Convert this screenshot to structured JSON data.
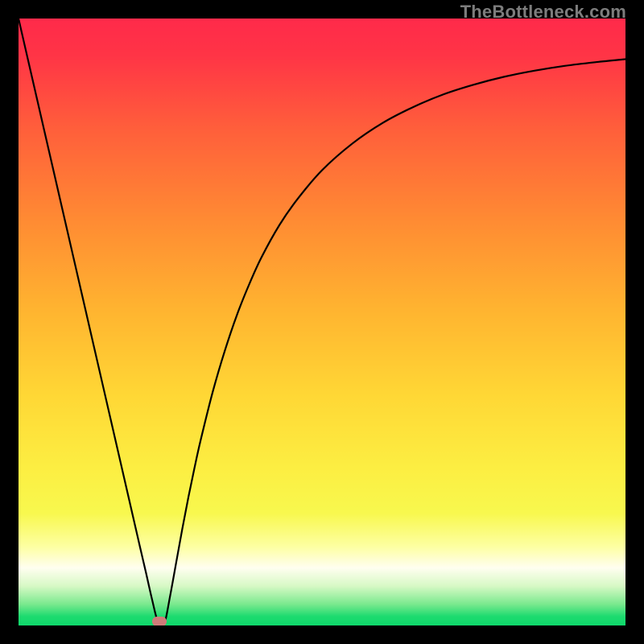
{
  "watermark": "TheBottleneck.com",
  "chart_data": {
    "type": "line",
    "title": "",
    "xlabel": "",
    "ylabel": "",
    "xlim": [
      0,
      100
    ],
    "ylim": [
      0,
      100
    ],
    "grid": false,
    "legend": false,
    "background_gradient": {
      "stops": [
        {
          "pos": 0.0,
          "color": "#ff2a4a"
        },
        {
          "pos": 0.06,
          "color": "#ff3446"
        },
        {
          "pos": 0.18,
          "color": "#ff5e3b"
        },
        {
          "pos": 0.33,
          "color": "#ff8a33"
        },
        {
          "pos": 0.48,
          "color": "#ffb430"
        },
        {
          "pos": 0.62,
          "color": "#ffd735"
        },
        {
          "pos": 0.74,
          "color": "#fcee42"
        },
        {
          "pos": 0.815,
          "color": "#f8f84e"
        },
        {
          "pos": 0.87,
          "color": "#fdffa2"
        },
        {
          "pos": 0.905,
          "color": "#fffef0"
        },
        {
          "pos": 0.935,
          "color": "#d7f9c5"
        },
        {
          "pos": 0.965,
          "color": "#7ae98e"
        },
        {
          "pos": 0.985,
          "color": "#1ddb6f"
        },
        {
          "pos": 1.0,
          "color": "#0fd86b"
        }
      ]
    },
    "series": [
      {
        "name": "bottleneck-curve",
        "x": [
          0.0,
          2.0,
          4.0,
          6.0,
          8.0,
          10.0,
          12.0,
          14.0,
          16.0,
          18.0,
          20.0,
          21.0,
          22.0,
          23.0,
          24.0,
          25.0,
          26.0,
          27.0,
          28.0,
          29.0,
          30.0,
          32.0,
          34.0,
          36.0,
          38.0,
          40.0,
          43.0,
          46.0,
          50.0,
          55.0,
          60.0,
          65.0,
          70.0,
          75.0,
          80.0,
          85.0,
          90.0,
          95.0,
          100.0
        ],
        "values": [
          100.0,
          91.3,
          82.6,
          73.9,
          65.2,
          56.5,
          47.8,
          39.1,
          30.4,
          21.7,
          13.0,
          8.7,
          4.3,
          0.5,
          0.2,
          5.0,
          10.5,
          16.0,
          21.2,
          26.0,
          30.5,
          38.5,
          45.3,
          51.2,
          56.2,
          60.6,
          66.0,
          70.3,
          75.0,
          79.4,
          82.8,
          85.4,
          87.5,
          89.1,
          90.4,
          91.4,
          92.2,
          92.8,
          93.3
        ]
      }
    ],
    "marker": {
      "x": 23.2,
      "y": 0.6,
      "color": "#cf7b79"
    }
  }
}
